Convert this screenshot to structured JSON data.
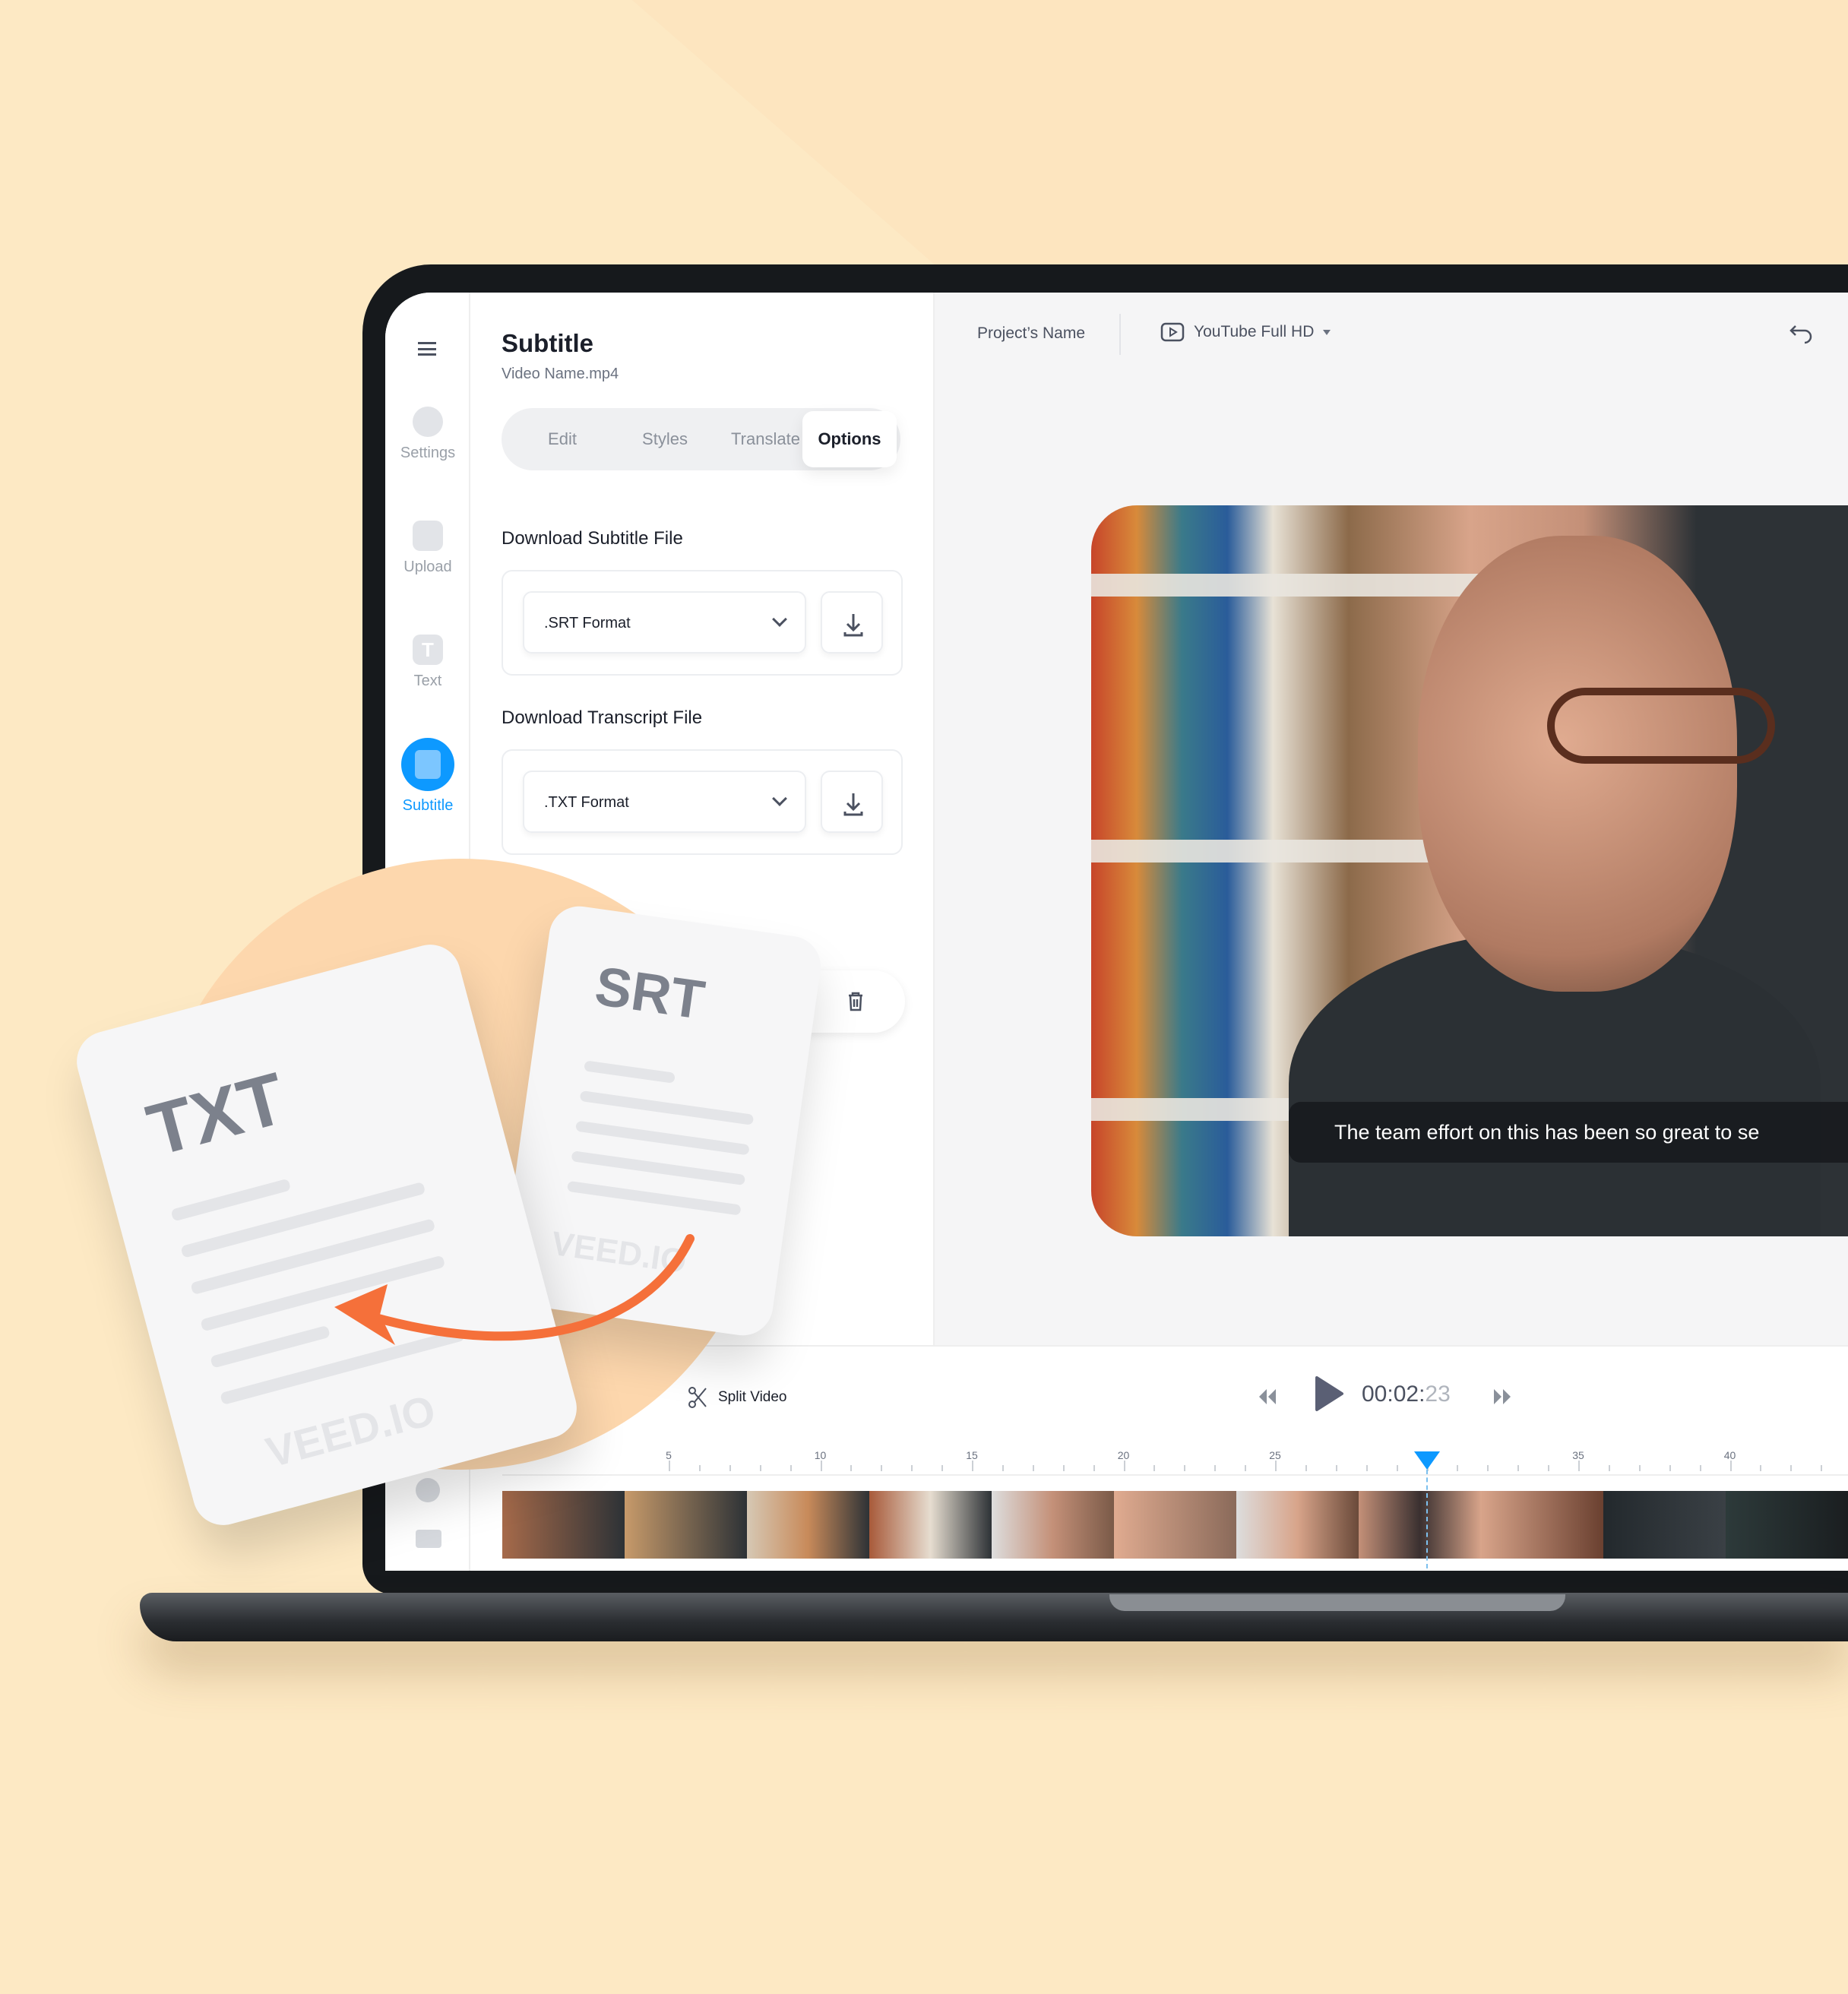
{
  "sidebar": {
    "items": [
      {
        "label": "Settings",
        "icon": "settings-icon"
      },
      {
        "label": "Upload",
        "icon": "upload-icon"
      },
      {
        "label": "Text",
        "icon": "text-icon"
      },
      {
        "label": "Subtitle",
        "icon": "subtitle-icon",
        "active": true
      }
    ]
  },
  "panel": {
    "title": "Subtitle",
    "filename": "Video Name.mp4",
    "tabs": [
      "Edit",
      "Styles",
      "Translate",
      "Options"
    ],
    "active_tab": "Options",
    "subtitle_section": {
      "label": "Download Subtitle File",
      "format": ".SRT Format"
    },
    "transcript_section": {
      "label": "Download Transcript File",
      "format": ".TXT Format"
    }
  },
  "header": {
    "project_name": "Project’s Name",
    "preset": "YouTube Full HD"
  },
  "video": {
    "caption": "The team effort on this has been so great to se"
  },
  "timeline": {
    "split_label": "Split Video",
    "time_main": "00:02:",
    "time_frames": "23",
    "ruler": [
      "5",
      "10",
      "15",
      "20",
      "25",
      "35",
      "40"
    ],
    "playhead_seconds": 30
  },
  "illustration": {
    "txt_label": "TXT",
    "srt_label": "SRT",
    "watermark": "VEED.IO"
  },
  "colors": {
    "accent": "#0d99ff",
    "background": "#fde9c4",
    "arrow": "#f5703a"
  }
}
